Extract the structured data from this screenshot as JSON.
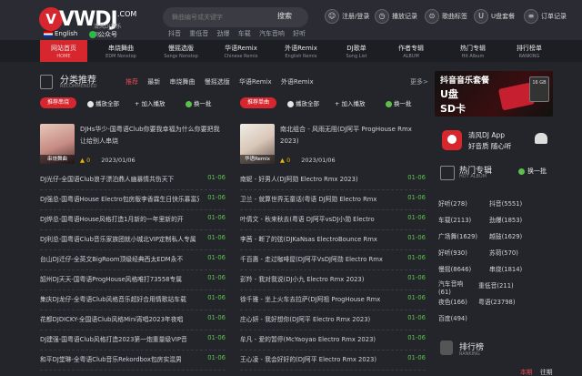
{
  "header": {
    "logo_text": "VWDJ",
    "logo_com": ".COM",
    "logo_sub": "清风DJ音乐网",
    "search_placeholder": "舞曲编号或关键字",
    "search_button": "搜索",
    "hot_words": [
      "抖音",
      "重低音",
      "劲爆",
      "车载",
      "汽车音响",
      "好听"
    ],
    "language": "English",
    "wechat": "公众号",
    "actions": [
      "注册/登录",
      "播放记录",
      "歌曲标签",
      "U盘套餐",
      "订单记录"
    ]
  },
  "nav": [
    {
      "cn": "网站首页",
      "en": "HOME"
    },
    {
      "cn": "串烧舞曲",
      "en": "EDM Nonstop"
    },
    {
      "cn": "慢摇选版",
      "en": "Songs Nonstop"
    },
    {
      "cn": "华语Remix",
      "en": "Chinese Remix"
    },
    {
      "cn": "外语Remix",
      "en": "English Remix"
    },
    {
      "cn": "DJ歌单",
      "en": "Song List"
    },
    {
      "cn": "作者专辑",
      "en": "ALBUM"
    },
    {
      "cn": "热门专辑",
      "en": "Hit Album"
    },
    {
      "cn": "排行榜单",
      "en": "RANKING"
    }
  ],
  "section": {
    "title": "分类推荐",
    "subtitle": "RECOMMENDED",
    "tabs": [
      "推荐",
      "最新",
      "串烧舞曲",
      "慢摇选版",
      "华语Remix",
      "外语Remix"
    ],
    "more": "更多>"
  },
  "left_col": {
    "badge": "推荐串烧",
    "play_all": "播放全部",
    "add_play": "加入播放",
    "refresh": "换一批",
    "feature": {
      "thumb_label": "串烧舞曲",
      "title": "DJHs华少-国粤语Club你要我幸福为什么你要把我让给别人串烧",
      "plays": "0",
      "date": "2023/01/06"
    },
    "rows": [
      {
        "name": "DJ光仔-全国语Club浪子漂泊鼎人幽暴情共伤天下",
        "date": "01-06"
      },
      {
        "name": "DJ强总-国粤语House Electro包房版李香霖生日快乐慕富兄",
        "date": "01-06"
      },
      {
        "name": "DJ烨总-国粤语House风格打造1月新的一年里新的开",
        "date": "01-06"
      },
      {
        "name": "DJ利总-国粤语Club音乐家族团就小城北VIP定制私人专属",
        "date": "01-06"
      },
      {
        "name": "台山DJ迁仔-全英文BigRoom顶级经典西太EDM永不",
        "date": "01-06"
      },
      {
        "name": "韶州DJ天天-国粤语ProgHouse风格唯打73558专属",
        "date": "01-06"
      },
      {
        "name": "集庆DJ龙仔-全粤语Club风格音乐超好合用情歌站车载",
        "date": "01-06"
      },
      {
        "name": "花都DJDICKY-全国语Club风格Mini宵唱2023年夜唱",
        "date": "01-06"
      },
      {
        "name": "DJ建强-国粤语Club风格打造2023第一炮重量级VIP音",
        "date": "01-06"
      },
      {
        "name": "和平DJ堂琳-全粤语Club音乐Rekordbox包房实混男",
        "date": "01-06"
      }
    ]
  },
  "right_col": {
    "badge": "推荐单曲",
    "play_all": "播放全部",
    "add_play": "加入播放",
    "refresh": "换一批",
    "feature": {
      "thumb_label": "华语Remix",
      "title": "南北组合 - 风雨无阻(DJ阿平 ProgHouse Rmx 2023)",
      "plays": "0",
      "date": "2023/01/06"
    },
    "rows": [
      {
        "name": "南妮 - 好男人(DJ阿勋 Electro Rmx 2023)",
        "date": "01-06"
      },
      {
        "name": "卫兰 - 就算世界无童话(粤语 DJ阿勋 Electro Rmx",
        "date": "01-06"
      },
      {
        "name": "叶倩文 - 秋来秋去(粤语 DJ阿平vsDJ小勋 Electro",
        "date": "01-06"
      },
      {
        "name": "李茜 - 断了的弦(DJKaNsas ElectroBounce Rmx",
        "date": "01-06"
      },
      {
        "name": "千百惠 - 走过咖啡屋(DJ阿平VsDJ阿勋 Electro Rmx",
        "date": "01-06"
      },
      {
        "name": "彭羚 - 我对我说(DJ小九 Electro Rmx 2023)",
        "date": "01-06"
      },
      {
        "name": "徐千雅 - 坐上火车去拉萨(DJ阿祖 ProgHouse Rmx",
        "date": "01-06"
      },
      {
        "name": "庄心妍 - 我好想你(DJ阿平 Electro Rmx 2023)",
        "date": "01-06"
      },
      {
        "name": "牟凡 - 爱的暂停(McYaoyao Electro Rmx 2023)",
        "date": "01-06"
      },
      {
        "name": "王心凌 - 我会好好的(DJ阿平 Electro Rmx 2023)",
        "date": "01-06"
      }
    ]
  },
  "sidebar": {
    "banner": {
      "line1": "抖音音乐套餐",
      "line2": "U盘",
      "line3": "SD卡",
      "card": "16 GB"
    },
    "app": {
      "name": "清风DJ App",
      "desc": "好音质 随心听"
    },
    "rank_title": "热门专辑",
    "rank_sub": "HOT ALBUM",
    "refresh": "换一批",
    "tags": [
      {
        "label": "好听(278)"
      },
      {
        "label": "抖音(5551)"
      },
      {
        "label": "车载(2113)"
      },
      {
        "label": "劲爆(1853)"
      },
      {
        "label": "广场舞(1629)"
      },
      {
        "label": "越鼓(1629)"
      },
      {
        "label": "好听(930)"
      },
      {
        "label": "苏荷(570)"
      },
      {
        "label": "慢摇(8646)"
      },
      {
        "label": "串烧(1814)"
      },
      {
        "label": "汽车音响(61)"
      },
      {
        "label": "重低音(211)"
      },
      {
        "label": "夜色(166)"
      },
      {
        "label": "粤语(23798)"
      },
      {
        "label": "百度(494)"
      }
    ],
    "ranking_title": "排行榜",
    "ranking_sub": "RANKING",
    "bottom_tabs": [
      "本期",
      "往期"
    ]
  }
}
